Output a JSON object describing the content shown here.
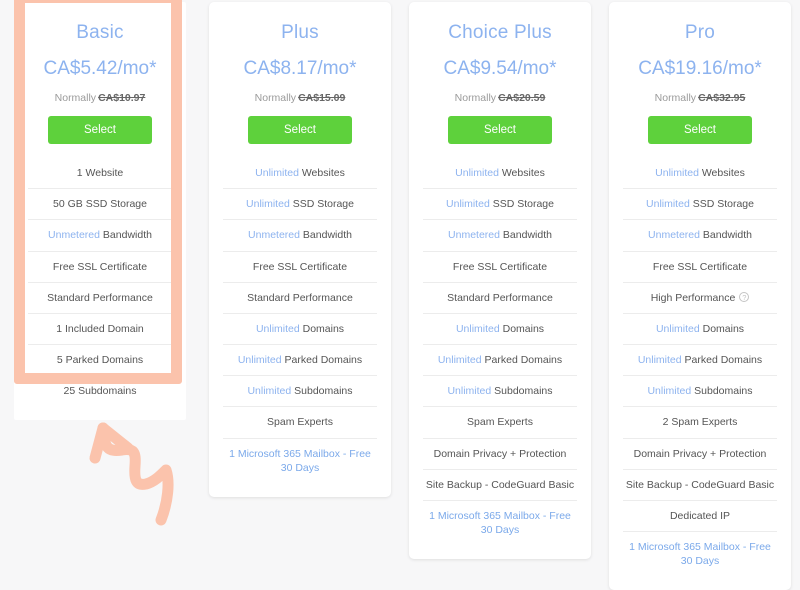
{
  "accent": {
    "blue": "#8db3ef",
    "link_blue": "#7ba9ea",
    "green": "#5ed13c",
    "highlight_salmon": "#fbc3ac",
    "text_gray": "#555555"
  },
  "annotation": {
    "type": "hand-drawn-squiggly-arrow",
    "color": "#fbc3ac",
    "points_to": "Basic plan card"
  },
  "plans": [
    {
      "name": "Basic",
      "price": "CA$5.42/mo*",
      "normally_label": "Normally",
      "normally_price": "CA$10.97",
      "select_label": "Select",
      "highlighted": true,
      "features": [
        {
          "highlight": "",
          "text": "1 Website",
          "link": false
        },
        {
          "highlight": "",
          "text": "50 GB SSD Storage",
          "link": false
        },
        {
          "highlight": "Unmetered",
          "text": " Bandwidth",
          "link": false
        },
        {
          "highlight": "",
          "text": "Free SSL Certificate",
          "link": false
        },
        {
          "highlight": "",
          "text": "Standard Performance",
          "link": false
        },
        {
          "highlight": "",
          "text": "1 Included Domain",
          "link": false
        },
        {
          "highlight": "",
          "text": "5 Parked Domains",
          "link": false
        },
        {
          "highlight": "",
          "text": "25 Subdomains",
          "link": false
        }
      ]
    },
    {
      "name": "Plus",
      "price": "CA$8.17/mo*",
      "normally_label": "Normally",
      "normally_price": "CA$15.09",
      "select_label": "Select",
      "highlighted": false,
      "features": [
        {
          "highlight": "Unlimited",
          "text": " Websites",
          "link": false
        },
        {
          "highlight": "Unlimited",
          "text": " SSD Storage",
          "link": false
        },
        {
          "highlight": "Unmetered",
          "text": " Bandwidth",
          "link": false
        },
        {
          "highlight": "",
          "text": "Free SSL Certificate",
          "link": false
        },
        {
          "highlight": "",
          "text": "Standard Performance",
          "link": false
        },
        {
          "highlight": "Unlimited",
          "text": " Domains",
          "link": false
        },
        {
          "highlight": "Unlimited",
          "text": " Parked Domains",
          "link": false
        },
        {
          "highlight": "Unlimited",
          "text": " Subdomains",
          "link": false
        },
        {
          "highlight": "",
          "text": "Spam Experts",
          "link": false
        },
        {
          "highlight": "",
          "text": "1 Microsoft 365 Mailbox - Free 30 Days",
          "link": true
        }
      ]
    },
    {
      "name": "Choice Plus",
      "price": "CA$9.54/mo*",
      "normally_label": "Normally",
      "normally_price": "CA$20.59",
      "select_label": "Select",
      "highlighted": false,
      "features": [
        {
          "highlight": "Unlimited",
          "text": " Websites",
          "link": false
        },
        {
          "highlight": "Unlimited",
          "text": " SSD Storage",
          "link": false
        },
        {
          "highlight": "Unmetered",
          "text": " Bandwidth",
          "link": false
        },
        {
          "highlight": "",
          "text": "Free SSL Certificate",
          "link": false
        },
        {
          "highlight": "",
          "text": "Standard Performance",
          "link": false
        },
        {
          "highlight": "Unlimited",
          "text": " Domains",
          "link": false
        },
        {
          "highlight": "Unlimited",
          "text": " Parked Domains",
          "link": false
        },
        {
          "highlight": "Unlimited",
          "text": " Subdomains",
          "link": false
        },
        {
          "highlight": "",
          "text": "Spam Experts",
          "link": false
        },
        {
          "highlight": "",
          "text": "Domain Privacy + Protection",
          "link": false
        },
        {
          "highlight": "",
          "text": "Site Backup - CodeGuard Basic",
          "link": false
        },
        {
          "highlight": "",
          "text": "1 Microsoft 365 Mailbox - Free 30 Days",
          "link": true
        }
      ]
    },
    {
      "name": "Pro",
      "price": "CA$19.16/mo*",
      "normally_label": "Normally",
      "normally_price": "CA$32.95",
      "select_label": "Select",
      "highlighted": false,
      "features": [
        {
          "highlight": "Unlimited",
          "text": " Websites",
          "link": false
        },
        {
          "highlight": "Unlimited",
          "text": " SSD Storage",
          "link": false
        },
        {
          "highlight": "Unmetered",
          "text": " Bandwidth",
          "link": false
        },
        {
          "highlight": "",
          "text": "Free SSL Certificate",
          "link": false
        },
        {
          "highlight": "",
          "text": "High Performance",
          "link": false,
          "info_icon": "?"
        },
        {
          "highlight": "Unlimited",
          "text": " Domains",
          "link": false
        },
        {
          "highlight": "Unlimited",
          "text": " Parked Domains",
          "link": false
        },
        {
          "highlight": "Unlimited",
          "text": " Subdomains",
          "link": false
        },
        {
          "highlight": "",
          "text": "2 Spam Experts",
          "link": false
        },
        {
          "highlight": "",
          "text": "Domain Privacy + Protection",
          "link": false
        },
        {
          "highlight": "",
          "text": "Site Backup - CodeGuard Basic",
          "link": false
        },
        {
          "highlight": "",
          "text": "Dedicated IP",
          "link": false
        },
        {
          "highlight": "",
          "text": "1 Microsoft 365 Mailbox - Free 30 Days",
          "link": true
        }
      ]
    }
  ]
}
